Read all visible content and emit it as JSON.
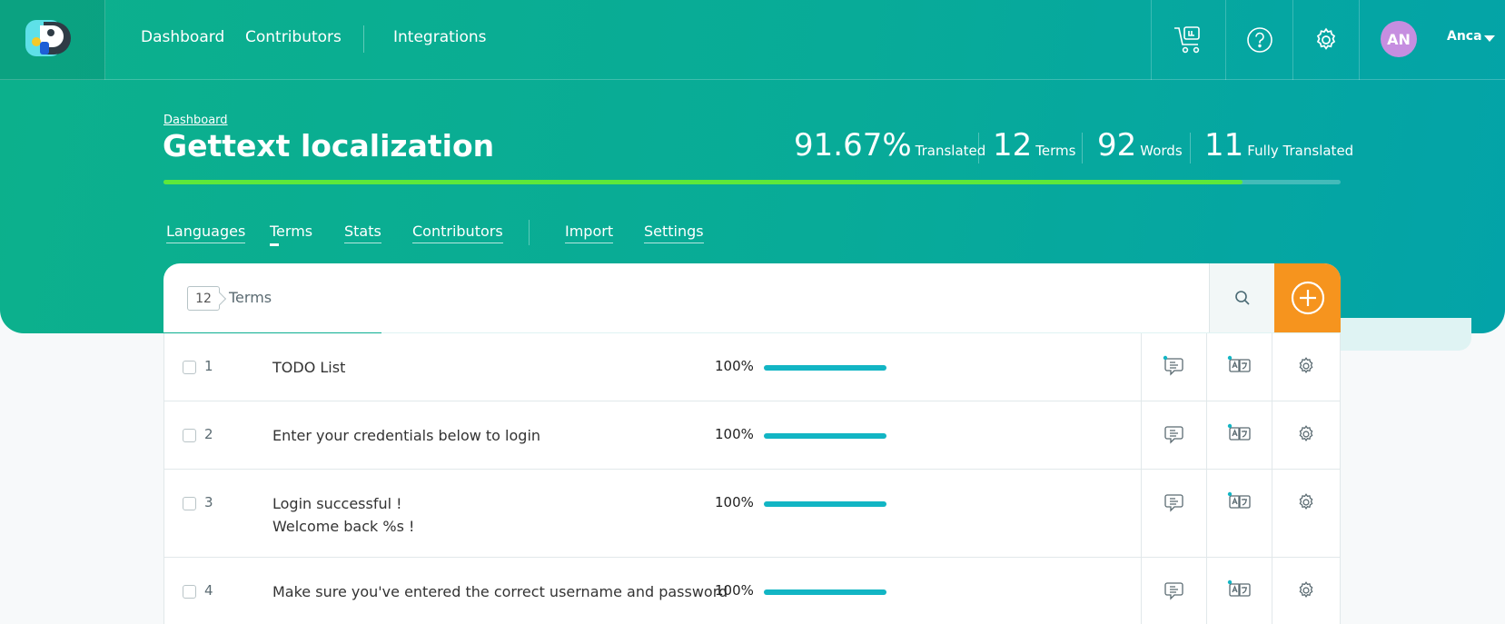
{
  "topbar": {
    "nav": [
      "Dashboard",
      "Contributors",
      "Integrations"
    ],
    "user": {
      "initials": "AN",
      "name": "Anca"
    },
    "icons": [
      "cart-icon",
      "help-icon",
      "gear-icon"
    ]
  },
  "project": {
    "breadcrumb": "Dashboard",
    "title": "Gettext localization",
    "stats": [
      {
        "value": "91.67%",
        "label": "Translated"
      },
      {
        "value": "12",
        "label": "Terms"
      },
      {
        "value": "92",
        "label": "Words"
      },
      {
        "value": "11",
        "label": "Fully Translated"
      }
    ],
    "progress_percent": 91.67
  },
  "tabs": {
    "items": [
      "Languages",
      "Terms",
      "Stats",
      "Contributors",
      "Import",
      "Settings"
    ],
    "active": "Terms"
  },
  "terms_panel": {
    "count": "12",
    "label": "Terms",
    "colors": {
      "add_button": "#f6941e",
      "bar": "#12b5c4",
      "progress": "#5de83b"
    }
  },
  "rows": [
    {
      "index": "1",
      "term": [
        "TODO List"
      ],
      "percent": "100%",
      "value": 100
    },
    {
      "index": "2",
      "term": [
        "Enter your credentials below to login"
      ],
      "percent": "100%",
      "value": 100
    },
    {
      "index": "3",
      "term": [
        "Login successful !",
        "Welcome back %s !"
      ],
      "percent": "100%",
      "value": 100
    },
    {
      "index": "4",
      "term": [
        "Make sure you've entered the correct username and password"
      ],
      "percent": "100%",
      "value": 100
    }
  ]
}
